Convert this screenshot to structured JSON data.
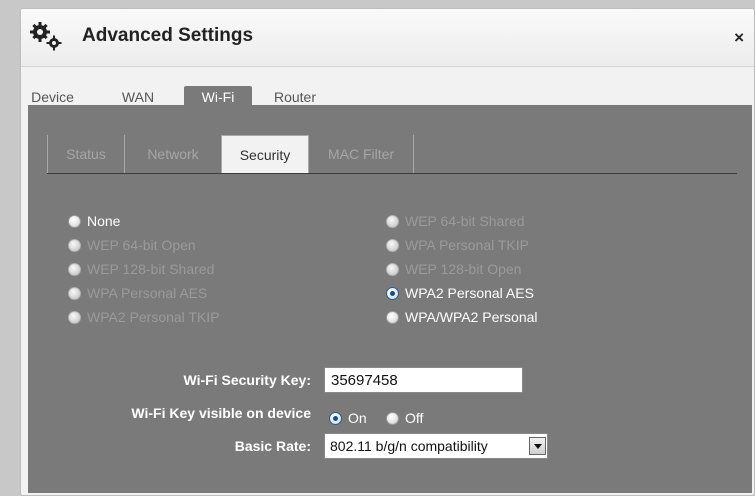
{
  "dialog": {
    "title": "Advanced Settings",
    "close_icon_text": "×"
  },
  "top_tabs": [
    "Device",
    "WAN",
    "Wi-Fi",
    "Router"
  ],
  "active_top_tab": "Wi-Fi",
  "sub_tabs": [
    "Status",
    "Network",
    "Security",
    "MAC Filter"
  ],
  "active_sub_tab": "Security",
  "security_options_left": [
    {
      "label": "None",
      "enabled": true,
      "checked": false
    },
    {
      "label": "WEP 64-bit Open",
      "enabled": false,
      "checked": false
    },
    {
      "label": "WEP 128-bit Shared",
      "enabled": false,
      "checked": false
    },
    {
      "label": "WPA Personal AES",
      "enabled": false,
      "checked": false
    },
    {
      "label": "WPA2 Personal TKIP",
      "enabled": false,
      "checked": false
    }
  ],
  "security_options_right": [
    {
      "label": "WEP 64-bit Shared",
      "enabled": false,
      "checked": false
    },
    {
      "label": "WPA Personal TKIP",
      "enabled": false,
      "checked": false
    },
    {
      "label": "WEP 128-bit Open",
      "enabled": false,
      "checked": false
    },
    {
      "label": "WPA2 Personal AES",
      "enabled": true,
      "checked": true
    },
    {
      "label": "WPA/WPA2 Personal",
      "enabled": true,
      "checked": false
    }
  ],
  "fields": {
    "security_key_label": "Wi-Fi Security Key:",
    "security_key_value": "35697458",
    "key_visible_label": "Wi-Fi Key visible on device",
    "key_visible_on": "On",
    "key_visible_off": "Off",
    "key_visible_selected": "On",
    "basic_rate_label": "Basic Rate:",
    "basic_rate_value": "802.11 b/g/n compatibility"
  }
}
